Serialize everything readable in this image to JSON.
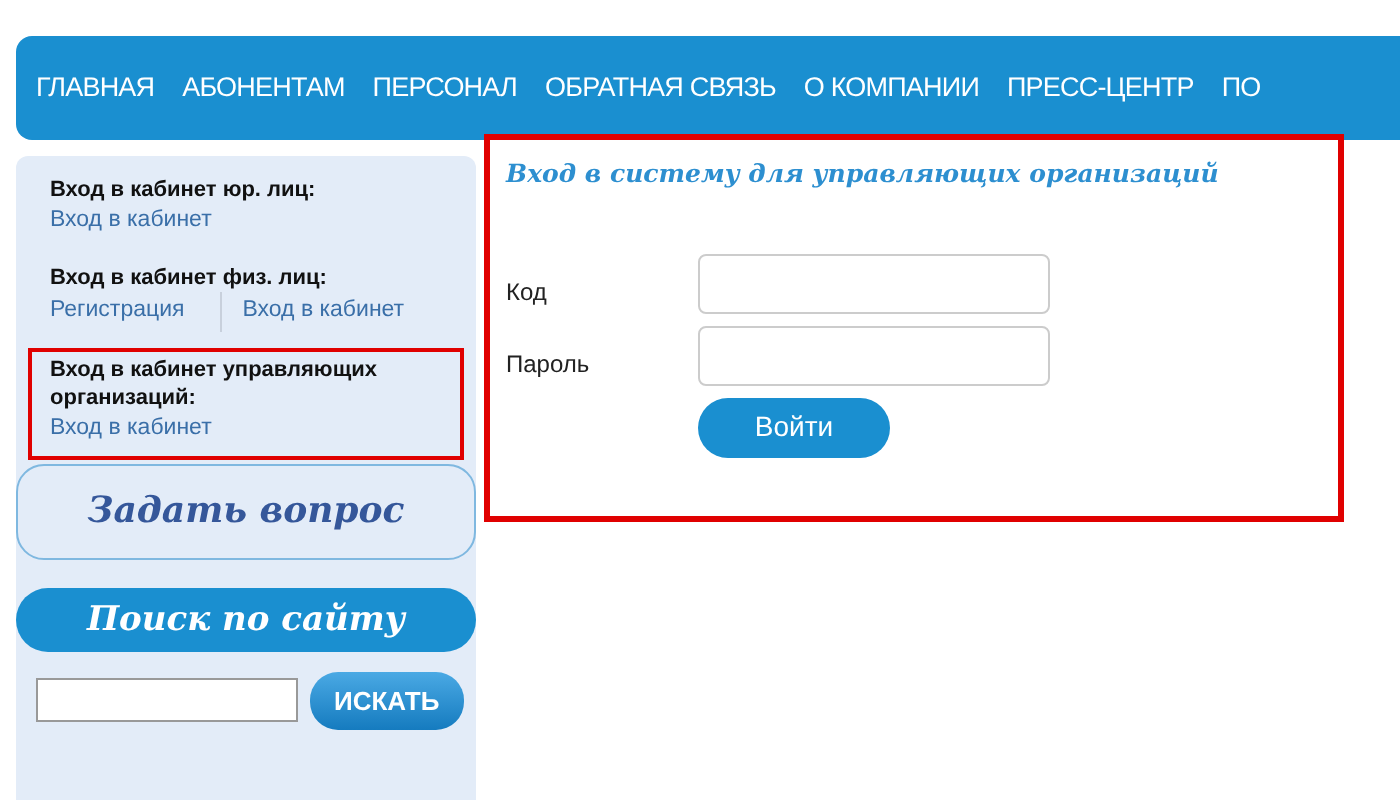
{
  "nav": {
    "items": [
      {
        "label": "ГЛАВНАЯ"
      },
      {
        "label": "АБОНЕНТАМ"
      },
      {
        "label": "ПЕРСОНАЛ"
      },
      {
        "label": "ОБРАТНАЯ СВЯЗЬ"
      },
      {
        "label": "О КОМПАНИИ"
      },
      {
        "label": "ПРЕСС-ЦЕНТР"
      },
      {
        "label": "ПО"
      }
    ]
  },
  "sidebar": {
    "sections": [
      {
        "title": "Вход в кабинет юр. лиц:",
        "links": [
          "Вход в кабинет"
        ],
        "highlighted": false
      },
      {
        "title": "Вход в кабинет физ. лиц:",
        "links": [
          "Регистрация",
          "Вход в кабинет"
        ],
        "highlighted": false
      },
      {
        "title": "Вход в кабинет управляющих организаций:",
        "links": [
          "Вход в кабинет"
        ],
        "highlighted": true
      }
    ],
    "ask_button": "Задать вопрос",
    "search": {
      "title": "Поиск по сайту",
      "button": "ИСКАТЬ"
    }
  },
  "login": {
    "title": "Вход в систему для управляющих организаций",
    "highlighted": true,
    "fields": [
      {
        "label": "Код"
      },
      {
        "label": "Пароль"
      }
    ],
    "button": "Войти"
  }
}
